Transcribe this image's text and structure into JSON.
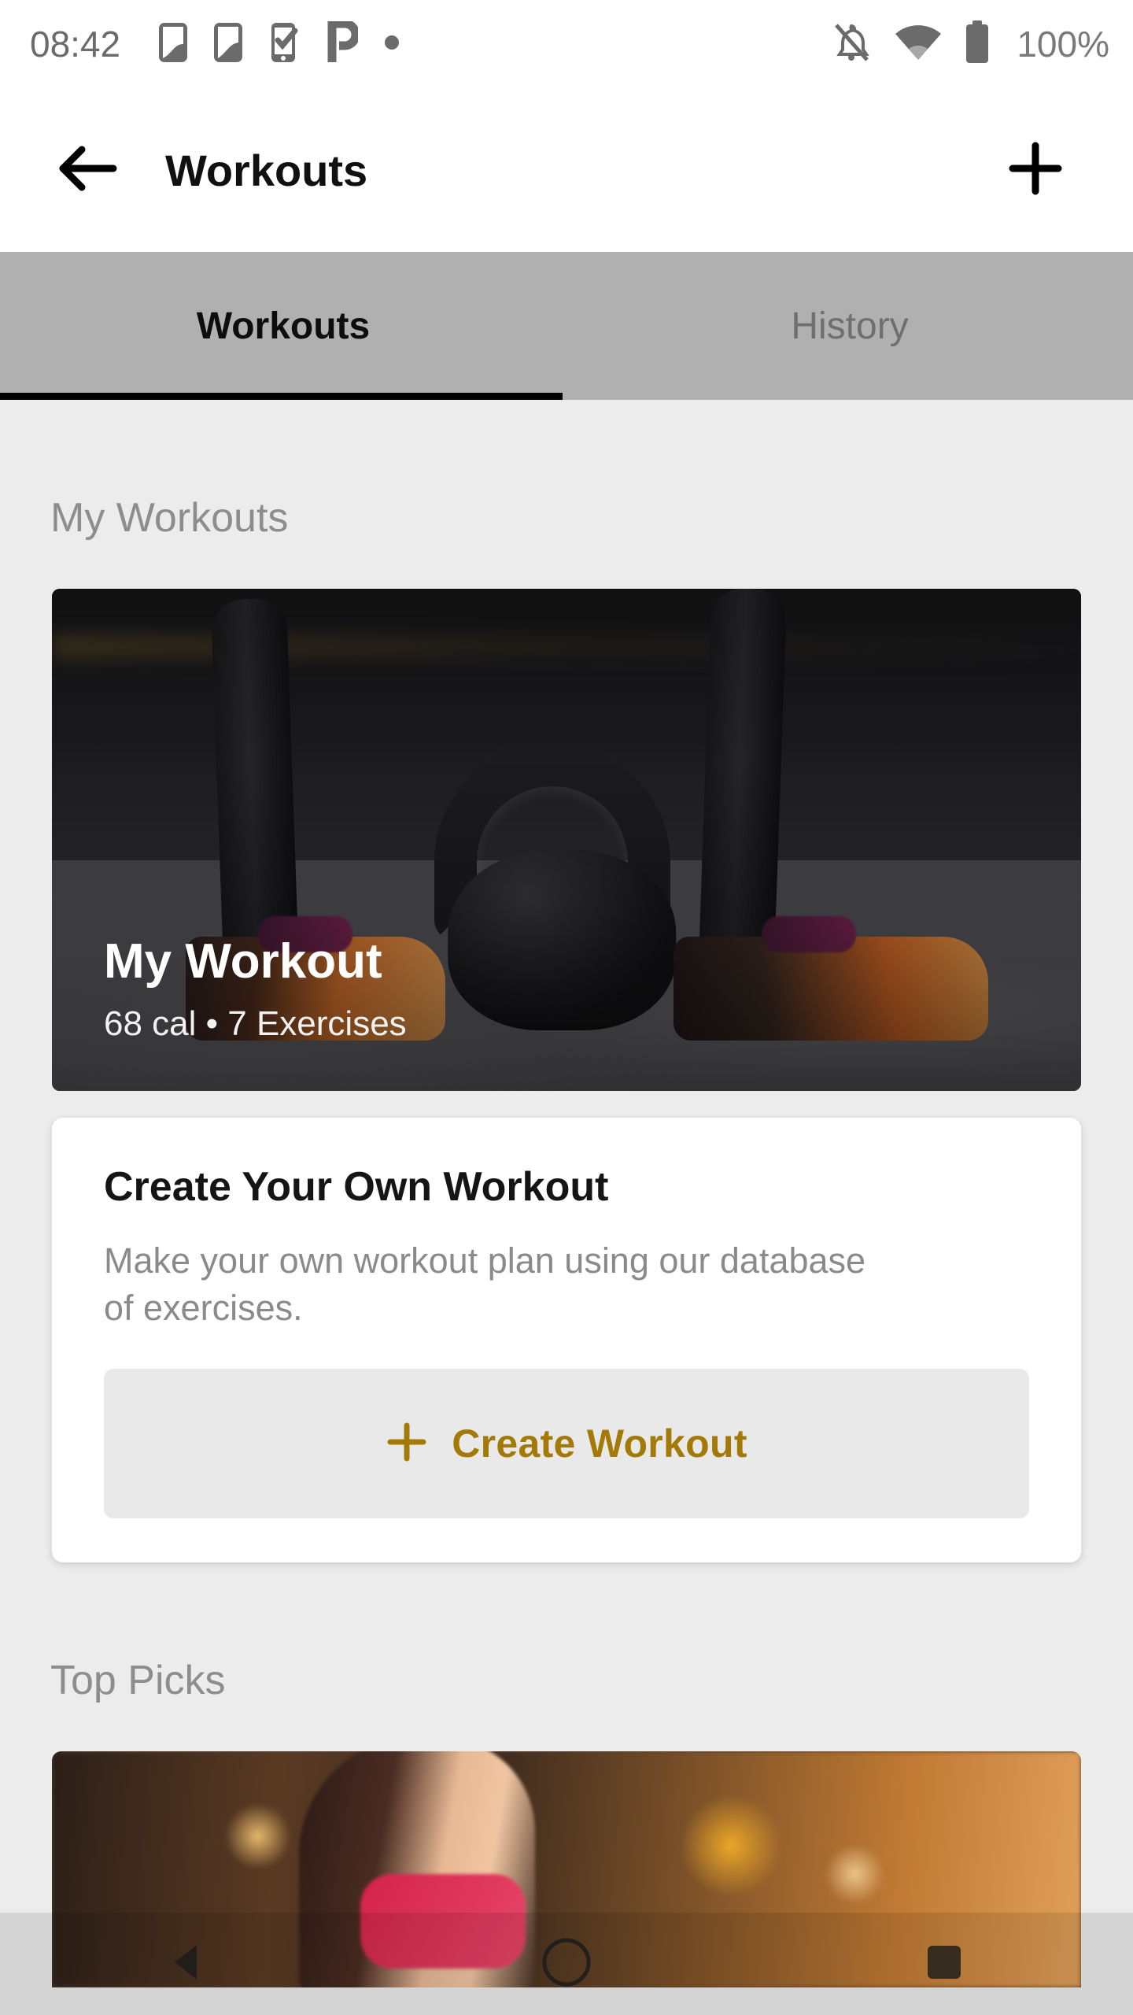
{
  "status_bar": {
    "time": "08:42",
    "battery_percent": "100%",
    "left_icons": [
      "device-transfer-icon",
      "device-transfer-icon",
      "phone-checkmark-icon",
      "p-glyph-icon",
      "dot-icon"
    ],
    "right_icons": [
      "notifications-off-icon",
      "wifi-icon",
      "battery-full-icon"
    ]
  },
  "app_bar": {
    "title": "Workouts",
    "back_icon": "arrow-left-icon",
    "add_icon": "plus-icon"
  },
  "tabs": [
    {
      "label": "Workouts",
      "active": true
    },
    {
      "label": "History",
      "active": false
    }
  ],
  "sections": {
    "my_workouts": {
      "heading": "My Workouts",
      "hero": {
        "title": "My Workout",
        "subtitle": "68 cal • 7 Exercises",
        "calories": "68 cal",
        "exercise_count": "7 Exercises"
      },
      "create_card": {
        "title": "Create Your Own Workout",
        "description": "Make your own workout plan using our database of exercises.",
        "button_label": "Create Workout",
        "button_icon": "plus-icon"
      }
    },
    "top_picks": {
      "heading": "Top Picks"
    }
  },
  "nav_bar": {
    "back_icon": "triangle-back-icon",
    "home_icon": "circle-home-icon",
    "recents_icon": "square-recents-icon"
  },
  "colors": {
    "accent_gold": "#a37a07",
    "tab_bar_bg": "#b0b0b0",
    "page_bg": "#ececec",
    "card_bg": "#ffffff",
    "muted_text": "#8d8d8d"
  }
}
